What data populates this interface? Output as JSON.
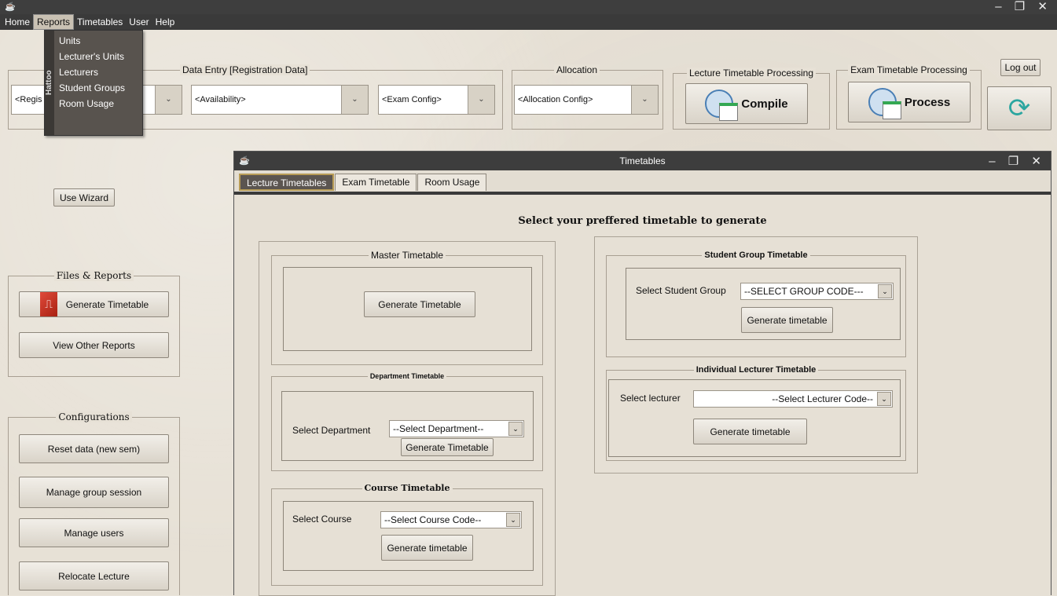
{
  "window": {
    "controls": "– ❐ ✕"
  },
  "menu": {
    "items": [
      "Home",
      "Reports",
      "Timetables",
      "User",
      "Help"
    ]
  },
  "reports_menu": {
    "side_label": "Hattoo",
    "items": [
      "Units",
      "Lecturer's Units",
      "Lecturers",
      "Student Groups",
      "Room Usage"
    ]
  },
  "toolbar": {
    "data_entry_label": "Data Entry [Registration Data]",
    "registration_combo": "<Regis",
    "availability_combo": "<Availability>",
    "exam_config_combo": "<Exam Config>",
    "allocation_label": "Allocation",
    "allocation_combo": "<Allocation Config>",
    "lecture_processing_label": "Lecture Timetable Processing",
    "compile_label": "Compile",
    "exam_processing_label": "Exam Timetable Processing",
    "process_label": "Process",
    "logout_label": "Log out"
  },
  "sidebar": {
    "wizard_label": "Use Wizard",
    "files_reports_label": "Files & Reports",
    "generate_timetable_label": "Generate Timetable",
    "view_reports_label": "View Other Reports",
    "configurations_label": "Configurations",
    "reset_label": "Reset data (new sem)",
    "manage_group_label": "Manage group session",
    "manage_users_label": "Manage users",
    "relocate_label": "Relocate Lecture"
  },
  "timetables_window": {
    "title": "Timetables",
    "tabs": [
      "Lecture Timetables",
      "Exam Timetable",
      "Room Usage"
    ],
    "heading": "Select your preffered timetable to generate",
    "master": {
      "label": "Master Timetable",
      "button": "Generate Timetable"
    },
    "department": {
      "label": "Department Timetable",
      "select_label": "Select Department",
      "select_value": "--Select Department--",
      "button": "Generate Timetable"
    },
    "course": {
      "label": "Course Timetable",
      "select_label": "Select Course",
      "select_value": "--Select Course Code--",
      "button": "Generate timetable"
    },
    "student_group": {
      "label": "Student Group Timetable",
      "select_label": "Select Student Group",
      "select_value": "--SELECT GROUP CODE---",
      "button": "Generate timetable"
    },
    "lecturer": {
      "label": "Individual Lecturer Timetable",
      "select_label": "Select lecturer",
      "select_value": "--Select Lecturer Code--",
      "button": "Generate timetable"
    }
  }
}
